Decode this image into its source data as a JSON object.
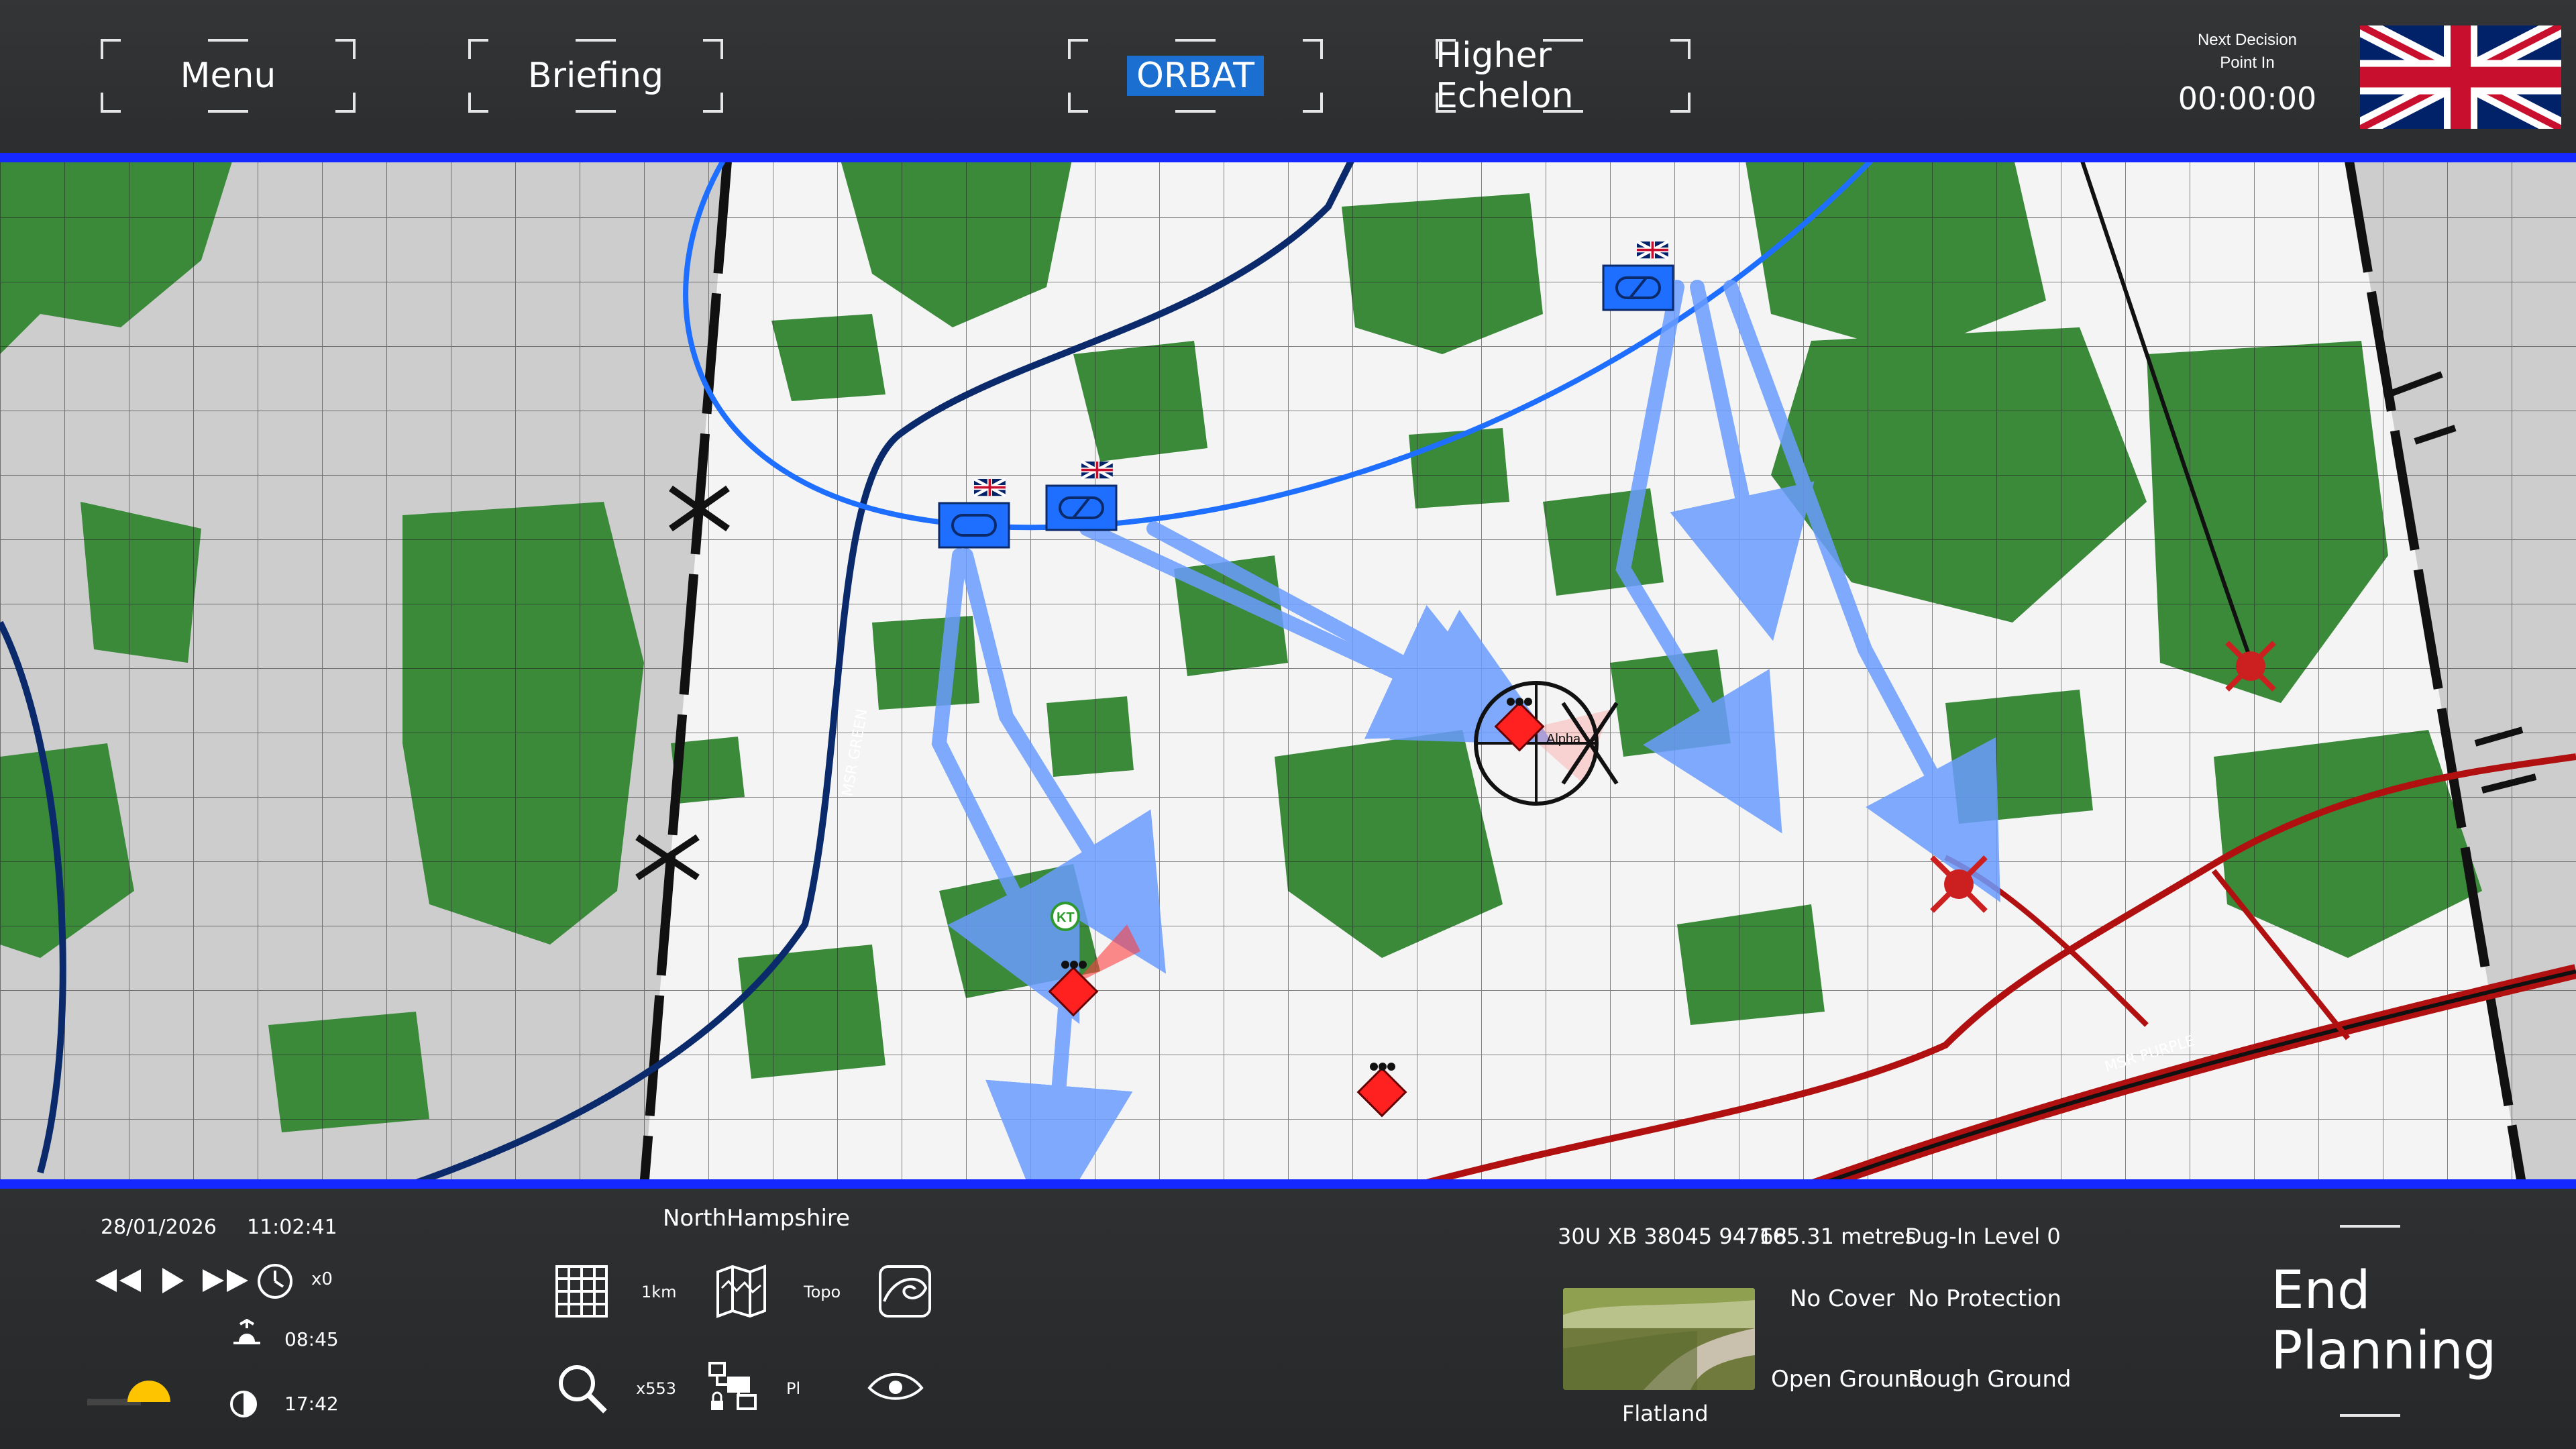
{
  "topbar": {
    "menu_label": "Menu",
    "briefing_label": "Briefing",
    "orbat_label": "ORBAT",
    "higher_echelon_label": "Higher Echelon",
    "decision_label_1": "Next Decision",
    "decision_label_2": "Point In",
    "decision_time": "00:00:00",
    "flag_icon": "uk-flag-icon"
  },
  "map": {
    "objective_label": "Alpha",
    "kt_label": "KT",
    "road_label_green": "MSR GREEN",
    "road_label_purple": "MSR PURPLE",
    "colors": {
      "friendly": "#1e6fff",
      "enemy": "#ff2020",
      "forest": "#3a8a3a",
      "msr_red": "#b01010"
    }
  },
  "bottombar": {
    "date": "28/01/2026",
    "clock": "11:02:41",
    "speed": "x0",
    "sunrise": "08:45",
    "sunset": "17:42",
    "region": "NorthHampshire",
    "grid_label": "1km",
    "topo_label": "Topo",
    "zoom_label": "x553",
    "pl_label": "Pl",
    "coords": "30U XB 38045 94768",
    "elevation": "165.31 metres",
    "dug_in": "Dug-In Level 0",
    "cover": "No Cover",
    "protection": "No Protection",
    "ground_open": "Open Ground",
    "ground_rough": "Rough Ground",
    "terrain_type": "Flatland",
    "end_planning": "End Planning"
  }
}
